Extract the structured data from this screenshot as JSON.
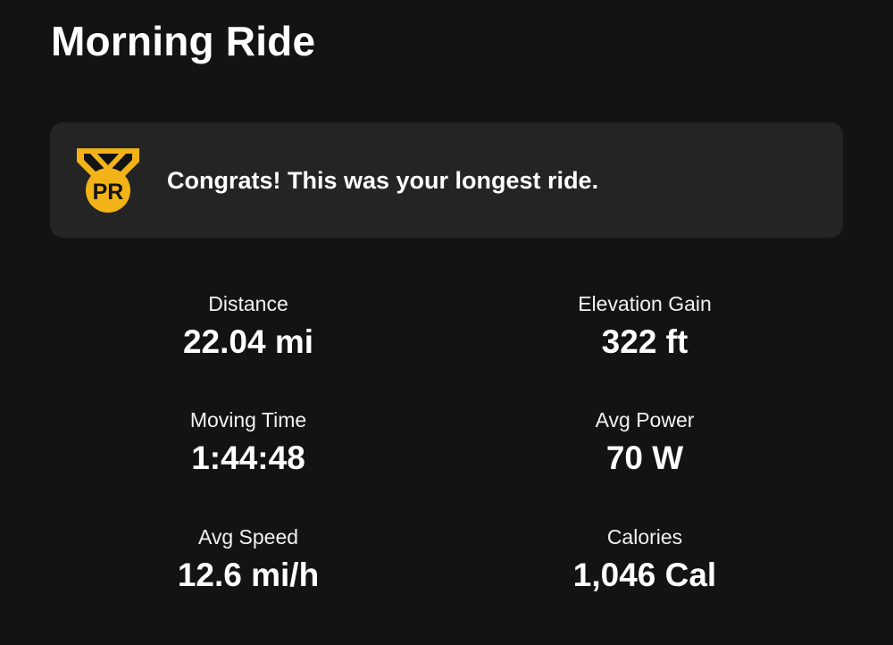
{
  "activity": {
    "title": "Morning Ride"
  },
  "achievement": {
    "badge_text": "PR",
    "message": "Congrats! This was your longest ride.",
    "badge_color": "#F2B318",
    "icon": "pr-medal-icon"
  },
  "stats": [
    {
      "label": "Distance",
      "value": "22.04 mi"
    },
    {
      "label": "Elevation Gain",
      "value": "322 ft"
    },
    {
      "label": "Moving Time",
      "value": "1:44:48"
    },
    {
      "label": "Avg Power",
      "value": "70 W"
    },
    {
      "label": "Avg Speed",
      "value": "12.6 mi/h"
    },
    {
      "label": "Calories",
      "value": "1,046 Cal"
    }
  ],
  "colors": {
    "background": "#131313",
    "card": "#242424",
    "text": "#FFFFFF"
  }
}
